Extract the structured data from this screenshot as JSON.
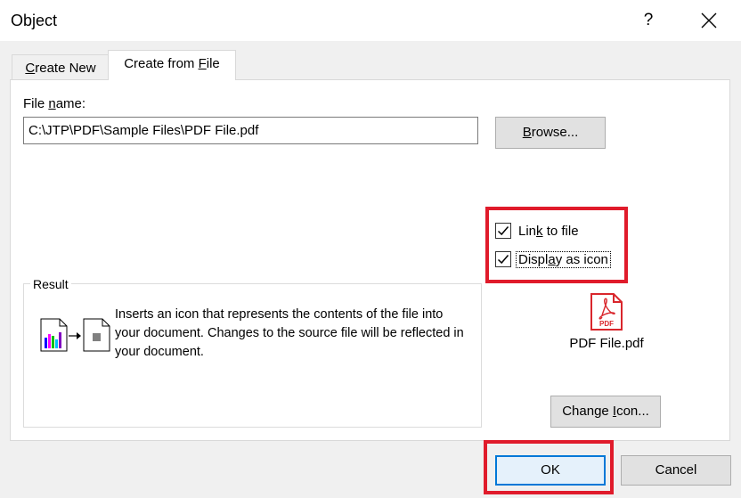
{
  "window": {
    "title": "Object",
    "help_glyph": "?"
  },
  "tabs": [
    {
      "label_pre": "",
      "label_key": "C",
      "label_post": "reate New"
    },
    {
      "label_pre": "Create from ",
      "label_key": "F",
      "label_post": "ile"
    }
  ],
  "file": {
    "label_pre": "File ",
    "label_key": "n",
    "label_post": "ame:",
    "value": "C:\\JTP\\PDF\\Sample Files\\PDF File.pdf"
  },
  "buttons": {
    "browse_key": "B",
    "browse_post": "rowse...",
    "change_pre": "Change ",
    "change_key": "I",
    "change_post": "con...",
    "ok": "OK",
    "cancel": "Cancel"
  },
  "options": {
    "link_pre": "Lin",
    "link_key": "k",
    "link_post": " to file",
    "display_pre": "Displ",
    "display_key": "a",
    "display_post": "y as icon"
  },
  "icon": {
    "badge": "PDF",
    "caption": "PDF File.pdf",
    "accent": "#d9262c"
  },
  "result": {
    "legend": "Result",
    "text": "Inserts an icon that represents the contents of the file into your document.  Changes to the source file will be reflected in your document."
  }
}
